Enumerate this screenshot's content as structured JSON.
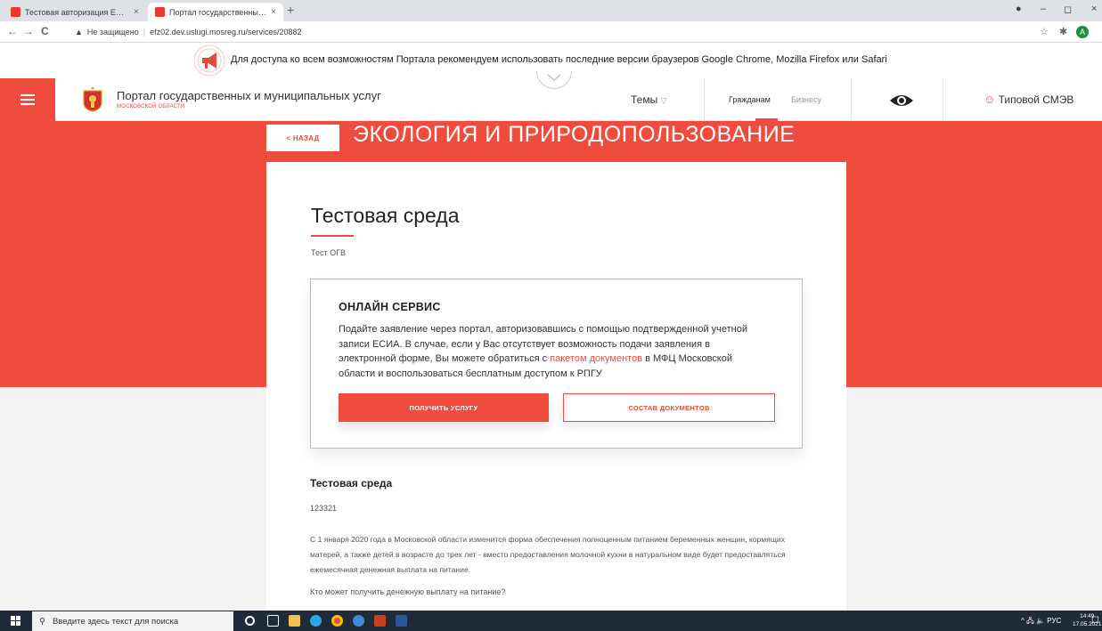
{
  "browser": {
    "tabs": [
      {
        "title": "Тестовая авторизация ЕСИА",
        "close": "×"
      },
      {
        "title": "Портал государственных и муниципальных",
        "close": "×"
      }
    ],
    "new_tab": "+",
    "window_controls": {
      "minimize": "–",
      "restore": "◻",
      "close": "×"
    },
    "back": "←",
    "forward": "→",
    "reload": "C",
    "security_icon": "▲",
    "security_label": "Не защищено",
    "separator": "|",
    "url": "efz02.dev.uslugi.mosreg.ru/services/20882",
    "star": "☆",
    "extensions": "✱",
    "profile_initial": "A"
  },
  "notice": {
    "text": "Для доступа ко всем возможностям Портала рекомендуем использовать последние версии браузеров Google Chrome, Mozilla Firefox или Safari"
  },
  "header": {
    "portal_title": "Портал государственных и муниципальных услуг",
    "portal_sub": "МОСКОВСКОЙ ОБЛАСТИ",
    "themes": "Темы",
    "themes_arrow": "▽",
    "citizens": "Гражданам",
    "business": "Бизнесу",
    "user_icon": "☺",
    "user": "Типовой СМЭВ"
  },
  "section": {
    "back": "< НАЗАД",
    "title": "ЭКОЛОГИЯ И ПРИРОДОПОЛЬЗОВАНИЕ"
  },
  "service": {
    "title": "Тестовая среда",
    "org": "Тест ОГВ",
    "online_heading": "ОНЛАЙН СЕРВИС",
    "online_text_1": "Подайте заявление через портал, авторизовавшись с помощью подтвержденной учетной записи ЕСИА. В случае, если у Вас отсутствует возможность подачи заявления в электронной форме, Вы можете обратиться с ",
    "online_link": "пакетом документов",
    "online_text_2": " в МФЦ Московской области и воспользоваться бесплатным доступом к РПГУ",
    "btn_get": "ПОЛУЧИТЬ УСЛУГУ",
    "btn_docs": "СОСТАВ ДОКУМЕНТОВ",
    "subheading": "Тестовая среда",
    "code": "123321",
    "description": "С 1 января 2020 года в Московской области изменится форма обеспечения полноценным питанием беременных женщин, кормящих матерей, а также детей в возрасте до трех лет - вместо предоставления молочной кухни в натуральном виде будет предоставляться ежемесячная денежная выплата на питание.",
    "question": "Кто может получить денежную выплату на питание?"
  },
  "taskbar": {
    "search_icon": "⚲",
    "search_placeholder": "Введите здесь текст для поиска",
    "tray": "^ 🖧 🔈 РУС",
    "time": "14:49",
    "date": "17.05.2021",
    "notifications": "☐"
  },
  "colors": {
    "accent": "#ef4b3f",
    "taskbar": "#1f2b3b"
  }
}
